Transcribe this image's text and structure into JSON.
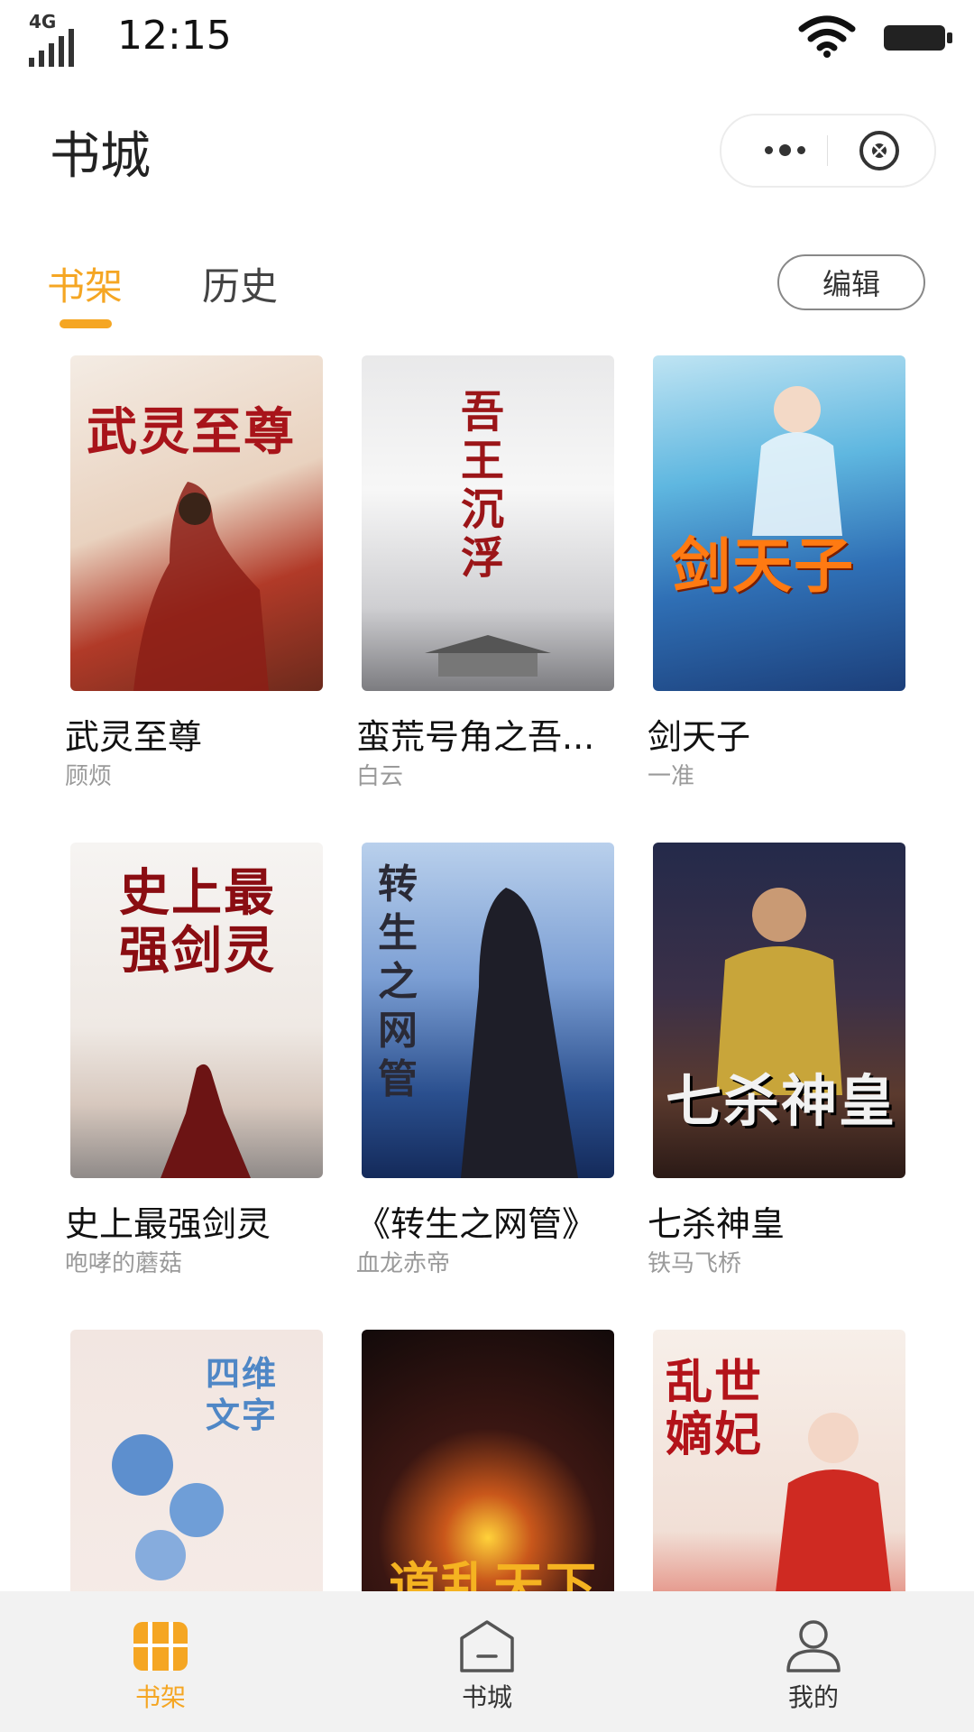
{
  "status_bar": {
    "network": "4G",
    "time": "12:15"
  },
  "header": {
    "title": "书城"
  },
  "tabs": [
    {
      "label": "书架",
      "active": true
    },
    {
      "label": "历史",
      "active": false
    }
  ],
  "edit_label": "编辑",
  "books": [
    {
      "title": "武灵至尊",
      "author": "顾烦"
    },
    {
      "title": "蛮荒号角之吾...",
      "author": "白云"
    },
    {
      "title": "剑天子",
      "author": "一准"
    },
    {
      "title": "史上最强剑灵",
      "author": "咆哮的蘑菇"
    },
    {
      "title": "《转生之网管》",
      "author": "血龙赤帝"
    },
    {
      "title": "七杀神皇",
      "author": "铁马飞桥"
    }
  ],
  "covers": [
    {
      "text": "武灵至尊"
    },
    {
      "text": "吾王沉浮"
    },
    {
      "text": "剑天子"
    },
    {
      "text": "史上最强剑灵"
    },
    {
      "text": "转生之网管"
    },
    {
      "text": "七杀神皇"
    },
    {
      "text": "四维文字"
    },
    {
      "text": "道乱天下"
    },
    {
      "text": "乱世嫡妃"
    }
  ],
  "bottom_nav": [
    {
      "label": "书架",
      "icon": "bookshelf-icon",
      "active": true
    },
    {
      "label": "书城",
      "icon": "store-icon",
      "active": false
    },
    {
      "label": "我的",
      "icon": "user-icon",
      "active": false
    }
  ],
  "colors": {
    "accent": "#f5a623",
    "tabbar_bg": "#f2f2f2",
    "author_text": "#9a9a9a"
  }
}
